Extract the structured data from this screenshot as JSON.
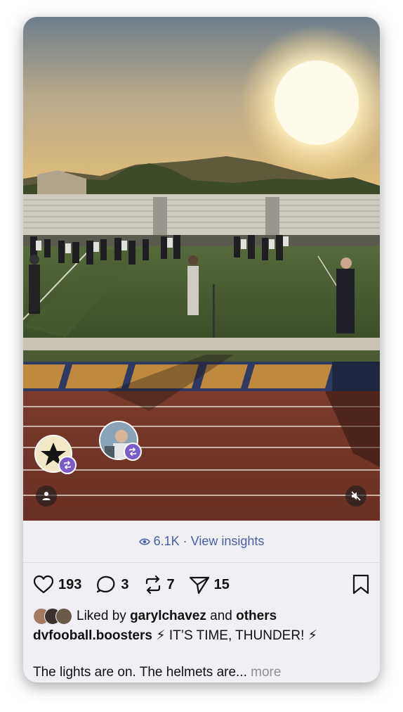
{
  "post": {
    "view_count": "6.1K",
    "separator": " · ",
    "view_insights": "View insights",
    "likes": "193",
    "comments": "3",
    "reposts": "7",
    "shares": "15",
    "liked_by_prefix": "Liked by",
    "liked_by_user": "garylchavez",
    "liked_by_and": "and",
    "liked_by_others": "others",
    "username": "dvfooball.boosters",
    "caption_line1": "⚡ IT’S TIME, THUNDER! ⚡",
    "caption_line2": "The lights are on. The helmets are...",
    "more": "more"
  },
  "colors": {
    "accent": "#4a5fa8",
    "repost_badge": "#7b5cc7",
    "background": "#efeff4"
  },
  "icons": [
    "eye-icon",
    "heart-icon",
    "comment-icon",
    "repost-icon",
    "send-icon",
    "bookmark-icon",
    "person-icon",
    "mute-icon"
  ]
}
